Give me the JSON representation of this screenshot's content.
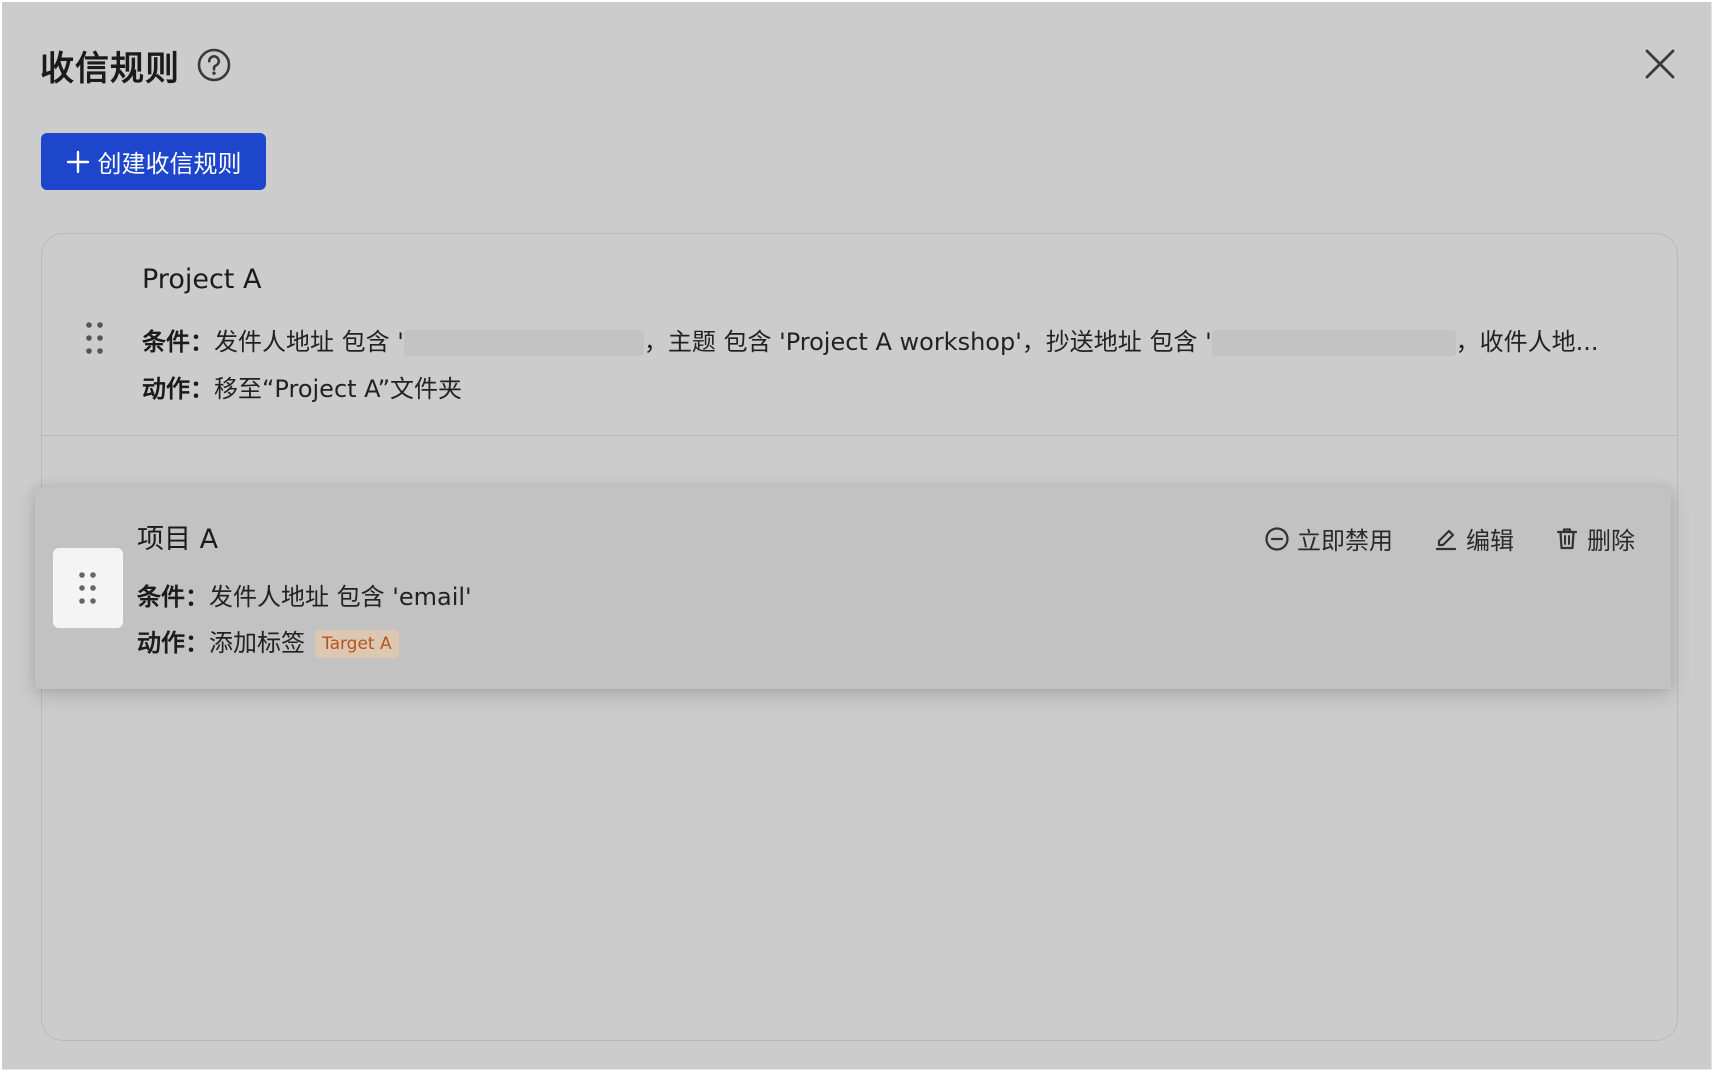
{
  "dialog": {
    "title": "收信规则"
  },
  "toolbar": {
    "create_label": "创建收信规则"
  },
  "rules": [
    {
      "name": "Project A",
      "condition_label": "条件：",
      "condition_parts": {
        "part1": "发件人地址 包含 '",
        "part2": "，主题 包含 'Project A workshop'，抄送地址 包含 '",
        "part3": "，收件人地..."
      },
      "action_label": "动作：",
      "action_text": "移至“Project A”文件夹"
    },
    {
      "name": "项目 A",
      "condition_label": "条件：",
      "condition_text": "发件人地址 包含 'email'",
      "action_label": "动作：",
      "action_text": "添加标签",
      "tag": "Target A",
      "actions": {
        "disable": "立即禁用",
        "edit": "编辑",
        "delete": "删除"
      }
    }
  ],
  "colors": {
    "primary": "#1d46cc",
    "tag_text": "#b8531c",
    "tag_bg": "#dcc7b2"
  },
  "icons": {
    "help": "question-circle-icon",
    "close": "close-icon",
    "plus": "plus-icon",
    "drag": "drag-handle-icon",
    "disable": "minus-circle-icon",
    "edit": "pencil-icon",
    "delete": "trash-icon"
  }
}
